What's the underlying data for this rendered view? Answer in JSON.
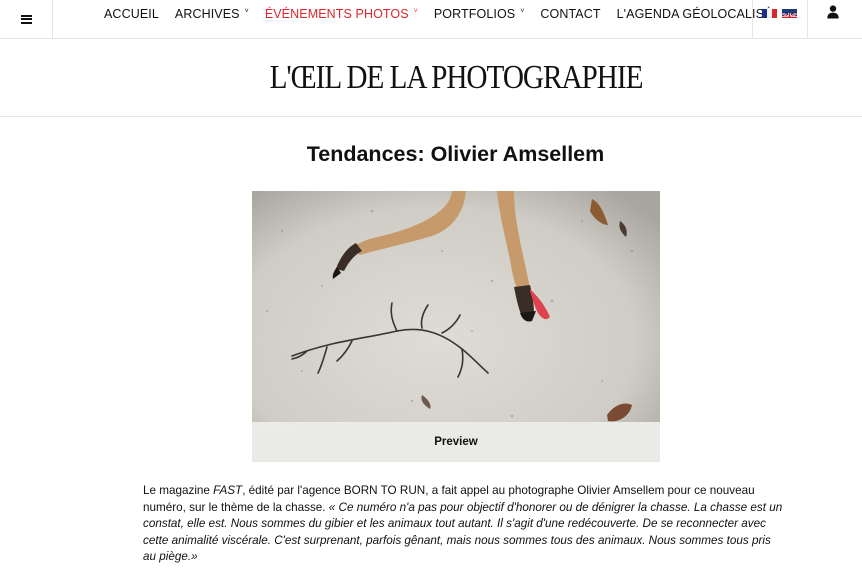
{
  "nav": {
    "menu_icon": "hamburger-icon",
    "items": [
      {
        "label": "ACCUEIL",
        "dropdown": false,
        "active": false
      },
      {
        "label": "ARCHIVES",
        "dropdown": true,
        "active": false
      },
      {
        "label": "ÉVÉNEMENTS PHOTOS",
        "dropdown": true,
        "active": true
      },
      {
        "label": "PORTFOLIOS",
        "dropdown": true,
        "active": false
      },
      {
        "label": "CONTACT",
        "dropdown": false,
        "active": false
      },
      {
        "label": "L'AGENDA GÉOLOCALISÉ",
        "dropdown": false,
        "active": false
      }
    ],
    "caret": "˅",
    "languages": [
      "french-flag-icon",
      "uk-flag-icon"
    ],
    "user_icon": "user-icon",
    "active_color": "#e0262a"
  },
  "site": {
    "title": "L'ŒIL DE LA PHOTOGRAPHIE"
  },
  "article": {
    "title": "Tendances: Olivier Amsellem",
    "image": {
      "caption_button": "Preview",
      "subject": "deer-legs-photo"
    },
    "paragraph": {
      "t1": "Le magazine ",
      "t2": "FAST",
      "t3": ", édité par l'agence BORN TO RUN, a fait appel au photographe Olivier Amsellem pour ce nouveau numéro, sur le thème de la chasse. ",
      "t4": "« Ce numéro n'a pas pour objectif d'honorer ou de dénigrer la chasse. La chasse est un constat, elle est. Nous sommes du gibier et les animaux tout autant. Il s'agit d'une redécouverte. De se reconnecter avec cette animalité viscérale. C'est surprenant, parfois gênant, mais nous sommes tous des animaux. Nous sommes tous pris au piège.»"
    }
  }
}
